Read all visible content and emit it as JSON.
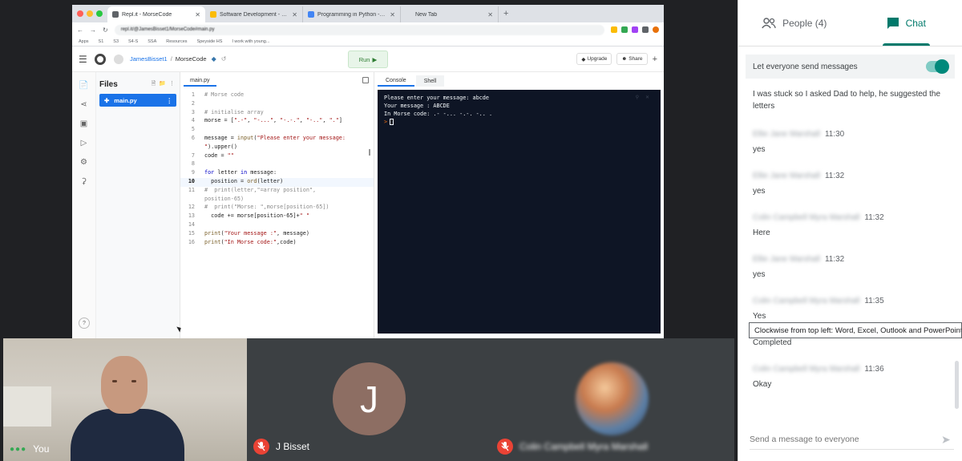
{
  "browser": {
    "tabs": [
      {
        "title": "Repl.it - MorseCode",
        "favicon_color": "#5f6368",
        "active": true
      },
      {
        "title": "Software Development - Goog",
        "favicon_color": "#fbbc04",
        "active": false
      },
      {
        "title": "Programming in Python - Less",
        "favicon_color": "#4285f4",
        "active": false
      },
      {
        "title": "New Tab",
        "favicon_color": "#dee1e6",
        "active": false
      }
    ],
    "new_tab_glyph": "+",
    "url": "repl.it/@JamesBisset1/MorseCode#main.py",
    "bookmarks": [
      "Apps",
      "S1",
      "S3",
      "S4-S",
      "SSA",
      "Resources",
      "Speyside HS",
      "I work with young..."
    ]
  },
  "repl": {
    "owner": "JamesBisset1",
    "separator": "/",
    "project": "MorseCode",
    "run_label": "Run",
    "upgrade_label": "Upgrade",
    "share_label": "Share",
    "files_title": "Files",
    "file_name": "main.py",
    "editor_tab": "main.py",
    "console_tab": "Console",
    "shell_tab": "Shell",
    "help_glyph": "?"
  },
  "code_lines": [
    {
      "n": "1",
      "html": "<span class='cmt'># Morse code</span>"
    },
    {
      "n": "2",
      "html": ""
    },
    {
      "n": "3",
      "html": "<span class='cmt'># initialise array</span>"
    },
    {
      "n": "4",
      "html": "morse = [<span class='str'>\".-\"</span>, <span class='str'>\"-...\"</span>, <span class='str'>\"-.-.\"</span>, <span class='str'>\"-..\"</span>, <span class='str'>\".\"</span>]"
    },
    {
      "n": "5",
      "html": ""
    },
    {
      "n": "6",
      "html": "message = <span class='fn'>input</span>(<span class='str'>\"Please enter your message:</span>"
    },
    {
      "n": "",
      "html": "<span class='str'>\"</span>).upper()"
    },
    {
      "n": "7",
      "html": "code = <span class='str'>\"\"</span>"
    },
    {
      "n": "8",
      "html": ""
    },
    {
      "n": "9",
      "html": "<span class='kw'>for</span> letter <span class='kw'>in</span> message:"
    },
    {
      "n": "10",
      "html": "  position = <span class='fn'>ord</span>(letter)",
      "cur": true
    },
    {
      "n": "11",
      "html": "<span class='cmt'>#  print(letter,\"=array position\",</span>"
    },
    {
      "n": "",
      "html": "<span class='cmt'>position-65)</span>"
    },
    {
      "n": "12",
      "html": "<span class='cmt'>#  print(\"Morse: \",morse[position-65])</span>"
    },
    {
      "n": "13",
      "html": "  code += morse[position-65]+<span class='str'>\" \"</span>"
    },
    {
      "n": "14",
      "html": ""
    },
    {
      "n": "15",
      "html": "<span class='fn'>print</span>(<span class='str'>\"Your message :\"</span>, message)"
    },
    {
      "n": "16",
      "html": "<span class='fn'>print</span>(<span class='str'>\"In Morse code:\"</span>,code)"
    }
  ],
  "console_output": [
    "Please enter your message: abcde",
    "Your message : ABCDE",
    "In Morse code: .- -... -.-. -.. ."
  ],
  "console_prompt": ">",
  "participants": {
    "you_label": "You",
    "j_initial": "J",
    "j_name": "J Bisset",
    "third_name": "Colin Campbell Myra Marshall"
  },
  "panel": {
    "people_label": "People (4)",
    "chat_label": "Chat",
    "toggle_label": "Let everyone send messages",
    "tooltip": "Clockwise from top left: Word, Excel, Outlook and PowerPoint",
    "composer_placeholder": "Send a message to everyone"
  },
  "chat": [
    {
      "text": "I was stuck so I asked Dad to help, he suggested the letters"
    },
    {
      "sender": "Ellie Jane Marshall",
      "time": "11:30",
      "text": "yes"
    },
    {
      "sender": "Ellie Jane Marshall",
      "time": "11:32",
      "text": "yes"
    },
    {
      "sender": "Colin Campbell Myra Marshall",
      "time": "11:32",
      "text": "Here"
    },
    {
      "sender": "Ellie Jane Marshall",
      "time": "11:32",
      "text": "yes"
    },
    {
      "sender": "Colin Campbell Myra Marshall",
      "time": "11:35",
      "text": "Yes"
    },
    {
      "text": "Completed"
    },
    {
      "sender": "Colin Campbell Myra Marshall",
      "time": "11:36",
      "text": "Okay"
    }
  ],
  "colors": {
    "accent": "#00796b",
    "repl_blue": "#1a73e8",
    "console_bg": "#0e1525",
    "mute_red": "#ea4335"
  }
}
